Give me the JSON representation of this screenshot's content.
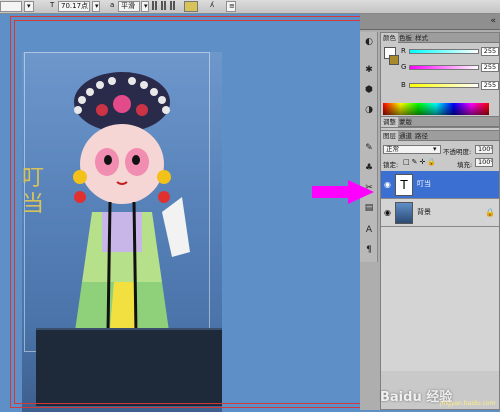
{
  "options_bar": {
    "font_size": "70.17点",
    "antialias": "平滑"
  },
  "canvas": {
    "vertical_text": "叮当"
  },
  "color_panel": {
    "tabs": [
      "颜色",
      "色板",
      "样式"
    ],
    "sliders": [
      {
        "label": "R",
        "value": "255"
      },
      {
        "label": "G",
        "value": "255"
      },
      {
        "label": "B",
        "value": "255"
      }
    ]
  },
  "adjust_panel": {
    "tabs": [
      "调整",
      "蒙版"
    ]
  },
  "layers_panel": {
    "tabs": [
      "图层",
      "通道",
      "路径"
    ],
    "blend_mode": "正常",
    "opacity_label": "不透明度:",
    "opacity_value": "100%",
    "lock_label": "锁定:",
    "fill_label": "填充:",
    "fill_value": "100%",
    "layers": [
      {
        "name": "叮当",
        "type": "text",
        "selected": true,
        "thumb_glyph": "T"
      },
      {
        "name": "背景",
        "type": "image",
        "selected": false
      }
    ]
  },
  "watermark": {
    "text": "Baidu 经验",
    "sub": "jingyan.baidu.com"
  },
  "colors": {
    "canvas_bg": "#5f8fc7",
    "selection": "#3b6fd2",
    "arrow": "#ff00ff",
    "text_color": "#d8c25a"
  }
}
